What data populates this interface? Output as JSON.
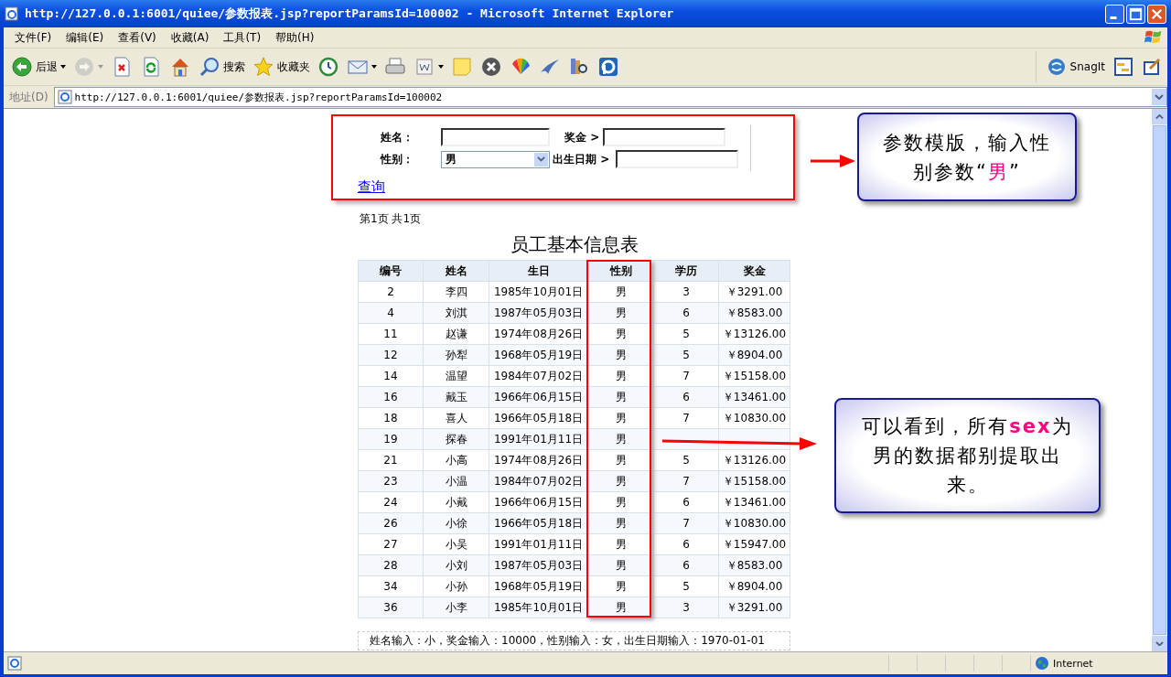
{
  "window": {
    "title": "http://127.0.0.1:6001/quiee/参数报表.jsp?reportParamsId=100002 - Microsoft Internet Explorer"
  },
  "menu": [
    "文件(F)",
    "编辑(E)",
    "查看(V)",
    "收藏(A)",
    "工具(T)",
    "帮助(H)"
  ],
  "toolbar": [
    {
      "kind": "back",
      "label": "后退",
      "dropdown": true,
      "disabled": false
    },
    {
      "kind": "forward",
      "dropdown": true,
      "disabled": true
    },
    {
      "kind": "stop",
      "dropdown": false,
      "disabled": false
    },
    {
      "kind": "refresh",
      "dropdown": false,
      "disabled": false
    },
    {
      "kind": "home",
      "dropdown": false,
      "disabled": false
    },
    {
      "kind": "search",
      "label": "搜索",
      "dropdown": false,
      "disabled": false
    },
    {
      "kind": "favorites",
      "label": "收藏夹",
      "dropdown": false,
      "disabled": false
    },
    {
      "kind": "history",
      "dropdown": false,
      "disabled": false
    },
    {
      "kind": "mail",
      "dropdown": true,
      "disabled": false
    },
    {
      "kind": "print",
      "dropdown": false,
      "disabled": false
    },
    {
      "kind": "word",
      "dropdown": true,
      "disabled": false
    },
    {
      "kind": "note",
      "dropdown": false,
      "disabled": false
    },
    {
      "kind": "xcircle",
      "dropdown": false,
      "disabled": false
    },
    {
      "kind": "fan",
      "dropdown": false,
      "disabled": false
    },
    {
      "kind": "bird",
      "dropdown": false,
      "disabled": false
    },
    {
      "kind": "research",
      "dropdown": false,
      "disabled": false
    },
    {
      "kind": "plogo",
      "dropdown": false,
      "disabled": false
    }
  ],
  "toolbar_right": {
    "snagit_label": "SnagIt"
  },
  "address": {
    "label": "地址(D)",
    "value": "http://127.0.0.1:6001/quiee/参数报表.jsp?reportParamsId=100002"
  },
  "form": {
    "name_label": "姓名：",
    "bonus_label": "奖金 >",
    "gender_label": "性别：",
    "gender_value": "男",
    "birth_label": "出生日期 >",
    "query_link": "查询"
  },
  "paging": "第1页 共1页",
  "report_title": "员工基本信息表",
  "table": {
    "columns": [
      "编号",
      "姓名",
      "生日",
      "性别",
      "学历",
      "奖金"
    ],
    "rows": [
      [
        "2",
        "李四",
        "1985年10月01日",
        "男",
        "3",
        "￥3291.00"
      ],
      [
        "4",
        "刘淇",
        "1987年05月03日",
        "男",
        "6",
        "￥8583.00"
      ],
      [
        "11",
        "赵谦",
        "1974年08月26日",
        "男",
        "5",
        "￥13126.00"
      ],
      [
        "12",
        "孙犁",
        "1968年05月19日",
        "男",
        "5",
        "￥8904.00"
      ],
      [
        "14",
        "温望",
        "1984年07月02日",
        "男",
        "7",
        "￥15158.00"
      ],
      [
        "16",
        "戴玉",
        "1966年06月15日",
        "男",
        "6",
        "￥13461.00"
      ],
      [
        "18",
        "喜人",
        "1966年05月18日",
        "男",
        "7",
        "￥10830.00"
      ],
      [
        "19",
        "探春",
        "1991年01月11日",
        "男"
      ],
      [
        "21",
        "小高",
        "1974年08月26日",
        "男",
        "5",
        "￥13126.00"
      ],
      [
        "23",
        "小温",
        "1984年07月02日",
        "男",
        "7",
        "￥15158.00"
      ],
      [
        "24",
        "小戴",
        "1966年06月15日",
        "男",
        "6",
        "￥13461.00"
      ],
      [
        "26",
        "小徐",
        "1966年05月18日",
        "男",
        "7",
        "￥10830.00"
      ],
      [
        "27",
        "小吴",
        "1991年01月11日",
        "男",
        "6",
        "￥15947.00"
      ],
      [
        "28",
        "小刘",
        "1987年05月03日",
        "男",
        "6",
        "￥8583.00"
      ],
      [
        "34",
        "小孙",
        "1968年05月19日",
        "男",
        "5",
        "￥8904.00"
      ],
      [
        "36",
        "小李",
        "1985年10月01日",
        "男",
        "3",
        "￥3291.00"
      ]
    ]
  },
  "footer_note": "姓名输入：小，奖金输入：10000，性别输入：女，出生日期输入：1970-01-01",
  "callouts": [
    {
      "parts": [
        {
          "text": "参数模版，输入性别参数“",
          "highlight": false
        },
        {
          "text": "男",
          "highlight": true
        },
        {
          "text": "”",
          "highlight": false
        }
      ]
    },
    {
      "parts": [
        {
          "text": "可以看到，所有",
          "highlight": false
        },
        {
          "text": "sex",
          "highlight": true
        },
        {
          "text": "为男的数据都别提取出来。",
          "highlight": false
        }
      ]
    }
  ],
  "status_bar": {
    "zone": "Internet"
  }
}
